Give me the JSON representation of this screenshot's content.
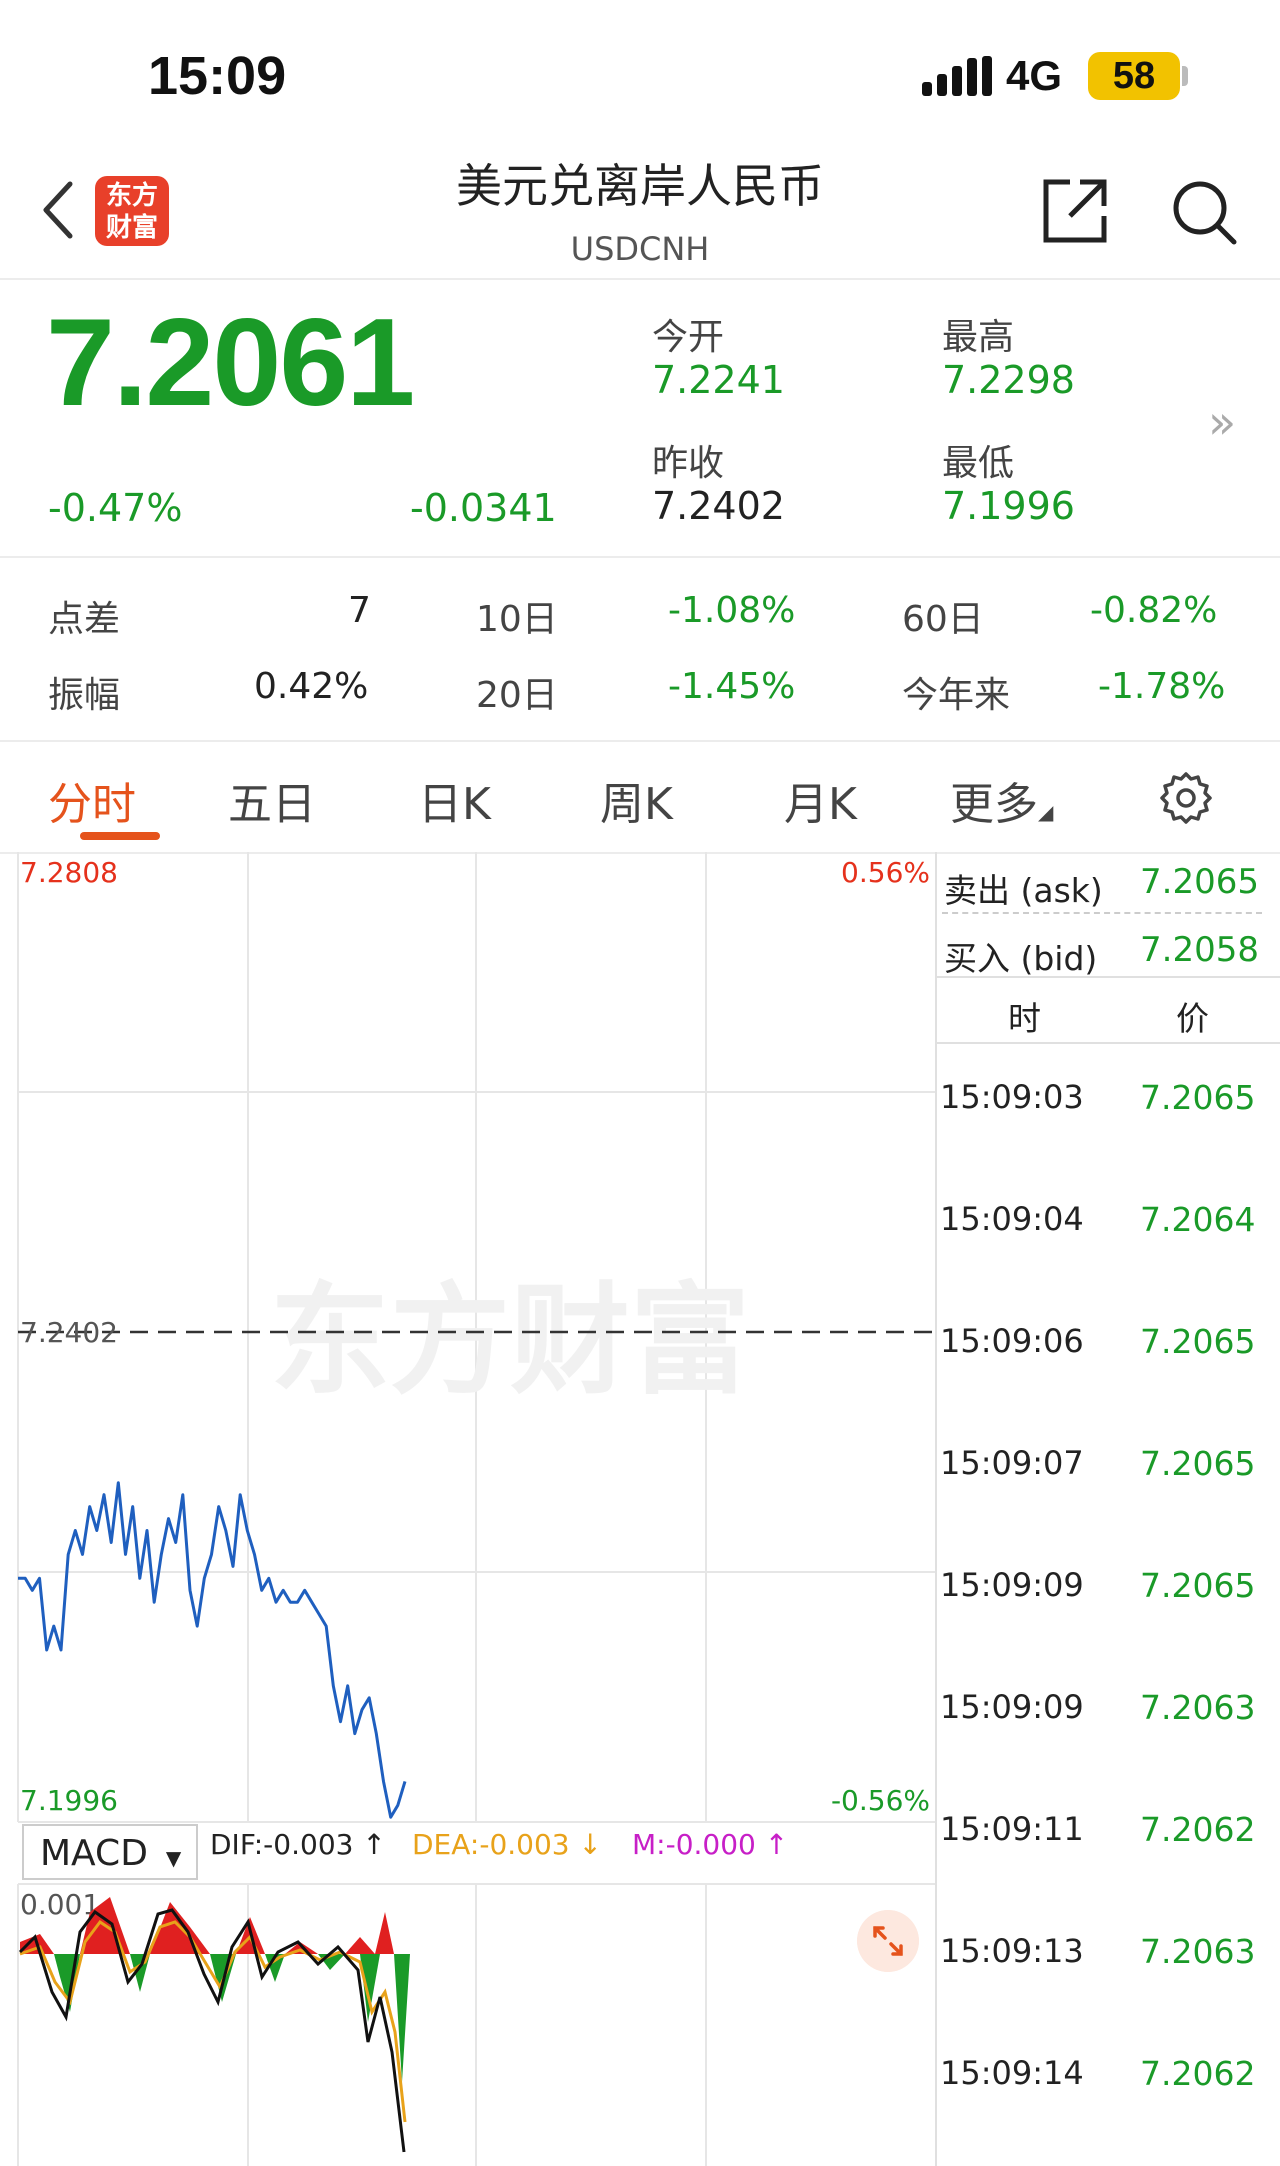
{
  "status_bar": {
    "time": "15:09",
    "network": "4G",
    "battery": "58"
  },
  "header": {
    "title": "美元兑离岸人民币",
    "code": "USDCNH",
    "logo_text_1": "东方",
    "logo_text_2": "财富"
  },
  "quote": {
    "price": "7.2061",
    "change_pct": "-0.47%",
    "change": "-0.0341",
    "open_label": "今开",
    "open": "7.2241",
    "high_label": "最高",
    "high": "7.2298",
    "prev_close_label": "昨收",
    "prev_close": "7.2402",
    "low_label": "最低",
    "low": "7.1996",
    "more_icon": "double-chevron-right-icon"
  },
  "stats": {
    "spread_label": "点差",
    "spread": "7",
    "d10_label": "10日",
    "d10": "-1.08%",
    "d60_label": "60日",
    "d60": "-0.82%",
    "amplitude_label": "振幅",
    "amplitude": "0.42%",
    "d20_label": "20日",
    "d20": "-1.45%",
    "ytd_label": "今年来",
    "ytd": "-1.78%"
  },
  "tabs": [
    {
      "label": "分时",
      "active": true
    },
    {
      "label": "五日"
    },
    {
      "label": "日K"
    },
    {
      "label": "周K"
    },
    {
      "label": "月K"
    },
    {
      "label": "更多"
    }
  ],
  "chart": {
    "top_price": "7.2808",
    "top_pct": "0.56%",
    "bottom_price": "7.1996",
    "bottom_pct": "-0.56%",
    "ref_price": "7.2402",
    "watermark": "东方财富",
    "macd_label": "MACD",
    "dif": "DIF:-0.003 ↑",
    "dea": "DEA:-0.003 ↓",
    "m": "M:-0.000 ↑",
    "macd_top": "0.001"
  },
  "chart_data": {
    "type": "line",
    "y_range": [
      7.1996,
      7.2808
    ],
    "reference": 7.2402,
    "series": [
      {
        "values": [
          7.22,
          7.22,
          7.219,
          7.22,
          7.214,
          7.216,
          7.214,
          7.222,
          7.224,
          7.222,
          7.226,
          7.224,
          7.227,
          7.223,
          7.228,
          7.222,
          7.226,
          7.22,
          7.224,
          7.218,
          7.222,
          7.225,
          7.223,
          7.227,
          7.219,
          7.216,
          7.22,
          7.222,
          7.226,
          7.224,
          7.221,
          7.227,
          7.224,
          7.222,
          7.219,
          7.22,
          7.218,
          7.219,
          7.218,
          7.218,
          7.219,
          7.218,
          7.217,
          7.216,
          7.211,
          7.208,
          7.211,
          7.207,
          7.209,
          7.21,
          7.207,
          7.203,
          7.2,
          7.201,
          7.203
        ]
      }
    ]
  },
  "right_panel": {
    "ask_label": "卖出 (ask)",
    "ask": "7.2065",
    "bid_label": "买入 (bid)",
    "bid": "7.2058",
    "col_time": "时",
    "col_price": "价",
    "ticks": [
      {
        "time": "15:09:03",
        "price": "7.2065"
      },
      {
        "time": "15:09:04",
        "price": "7.2064"
      },
      {
        "time": "15:09:06",
        "price": "7.2065"
      },
      {
        "time": "15:09:07",
        "price": "7.2065"
      },
      {
        "time": "15:09:09",
        "price": "7.2065"
      },
      {
        "time": "15:09:09",
        "price": "7.2063"
      },
      {
        "time": "15:09:11",
        "price": "7.2062"
      },
      {
        "time": "15:09:13",
        "price": "7.2063"
      },
      {
        "time": "15:09:14",
        "price": "7.2062"
      }
    ]
  }
}
